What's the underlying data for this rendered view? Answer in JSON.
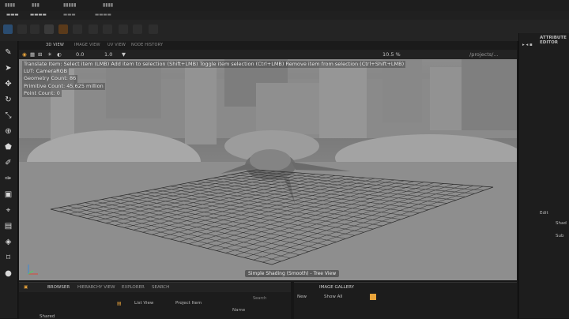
{
  "viewport_tabs": [
    "3D VIEW",
    "IMAGE VIEW",
    "UV VIEW",
    "NODE HISTORY"
  ],
  "viewport_toolbar": {
    "exposure": "0.0",
    "gamma": "1.0",
    "zoom": "10.5 %",
    "path": "/projects/..."
  },
  "overlay": {
    "hint": "Translate Item: Select item (LMB)  Add item to selection (Shift+LMB)  Toggle item selection (Ctrl+LMB)  Remove item from selection (Ctrl+Shift+LMB)",
    "lut": "LUT: CameraRGB",
    "geometry": "Geometry Count: 86",
    "primitive": "Primitive Count: 45.625 million",
    "point": "Point Count: 0"
  },
  "shading_label": "Simple Shading (Smooth) - Tree View",
  "browser": {
    "tabs": [
      "BROWSER",
      "HIERARCHY VIEW",
      "EXPLORER",
      "SEARCH"
    ],
    "list_mode": "List View",
    "project_item": "Project Item",
    "search_placeholder": "Search",
    "name_col": "Name",
    "folder": "Shared"
  },
  "gallery": {
    "tab": "IMAGE GALLERY",
    "new_label": "New",
    "show_all": "Show All"
  },
  "right_panel": {
    "title": "ATTRIBUTE EDITOR",
    "edit": "Edit",
    "item1": "Shad",
    "item2": "Sub"
  },
  "colors": {
    "accent": "#e8a33a",
    "blue": "#3a8ad8",
    "panel": "#1d1d1d"
  }
}
